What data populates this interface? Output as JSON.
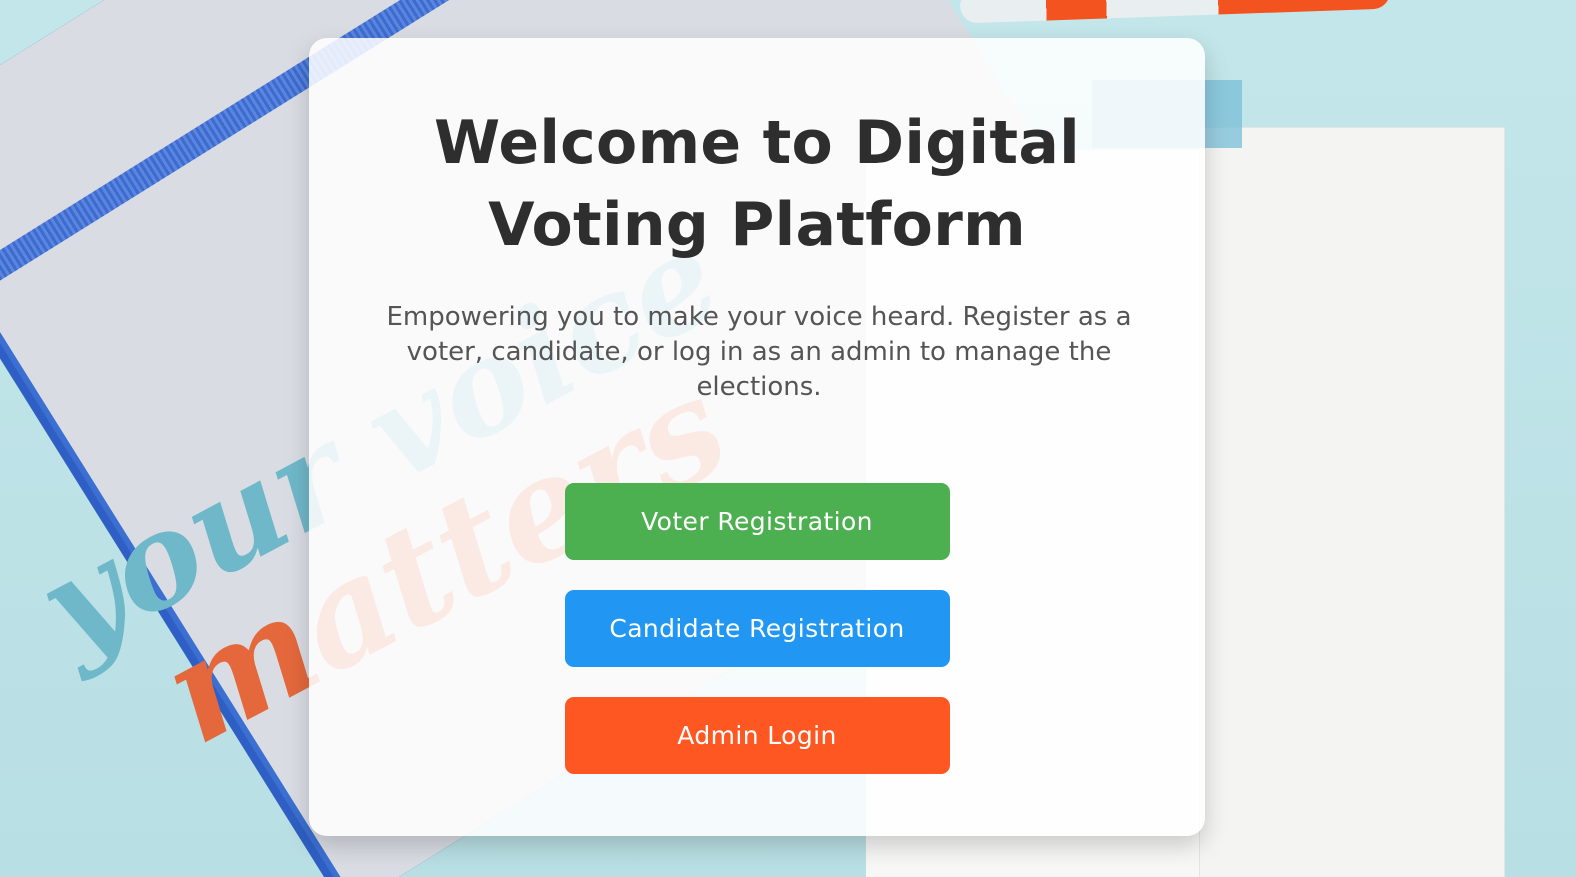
{
  "hero": {
    "title": "Welcome to Digital Voting Platform",
    "subtitle": "Empowering you to make your voice heard. Register as a voter, candidate, or log in as an admin to manage the elections."
  },
  "background": {
    "script_line_1": "your voice",
    "script_line_2": "matters"
  },
  "actions": {
    "voter_label": "Voter Registration",
    "candidate_label": "Candidate Registration",
    "admin_label": "Admin Login"
  },
  "colors": {
    "voter": "#4caf50",
    "candidate": "#2196f3",
    "admin": "#ff5722",
    "title_text": "#2e2e2e"
  }
}
